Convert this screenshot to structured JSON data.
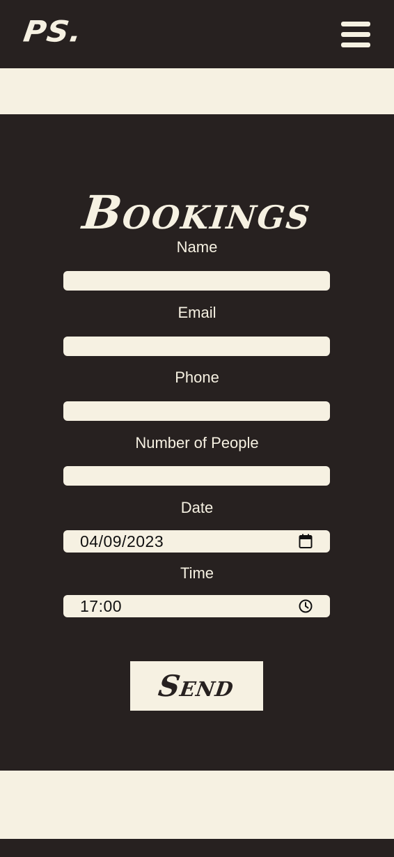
{
  "header": {
    "logo": "PS.",
    "menu_icon": "hamburger-menu-icon"
  },
  "bookings": {
    "title": "Bookings",
    "fields": {
      "name": {
        "label": "Name",
        "value": ""
      },
      "email": {
        "label": "Email",
        "value": ""
      },
      "phone": {
        "label": "Phone",
        "value": ""
      },
      "people": {
        "label": "Number of People",
        "value": ""
      },
      "date": {
        "label": "Date",
        "value": "04/09/2023",
        "icon": "calendar-icon"
      },
      "time": {
        "label": "Time",
        "value": "17:00",
        "icon": "clock-icon"
      }
    },
    "send_label": "Send"
  },
  "colors": {
    "dark": "#272120",
    "cream": "#f6f1e2"
  }
}
